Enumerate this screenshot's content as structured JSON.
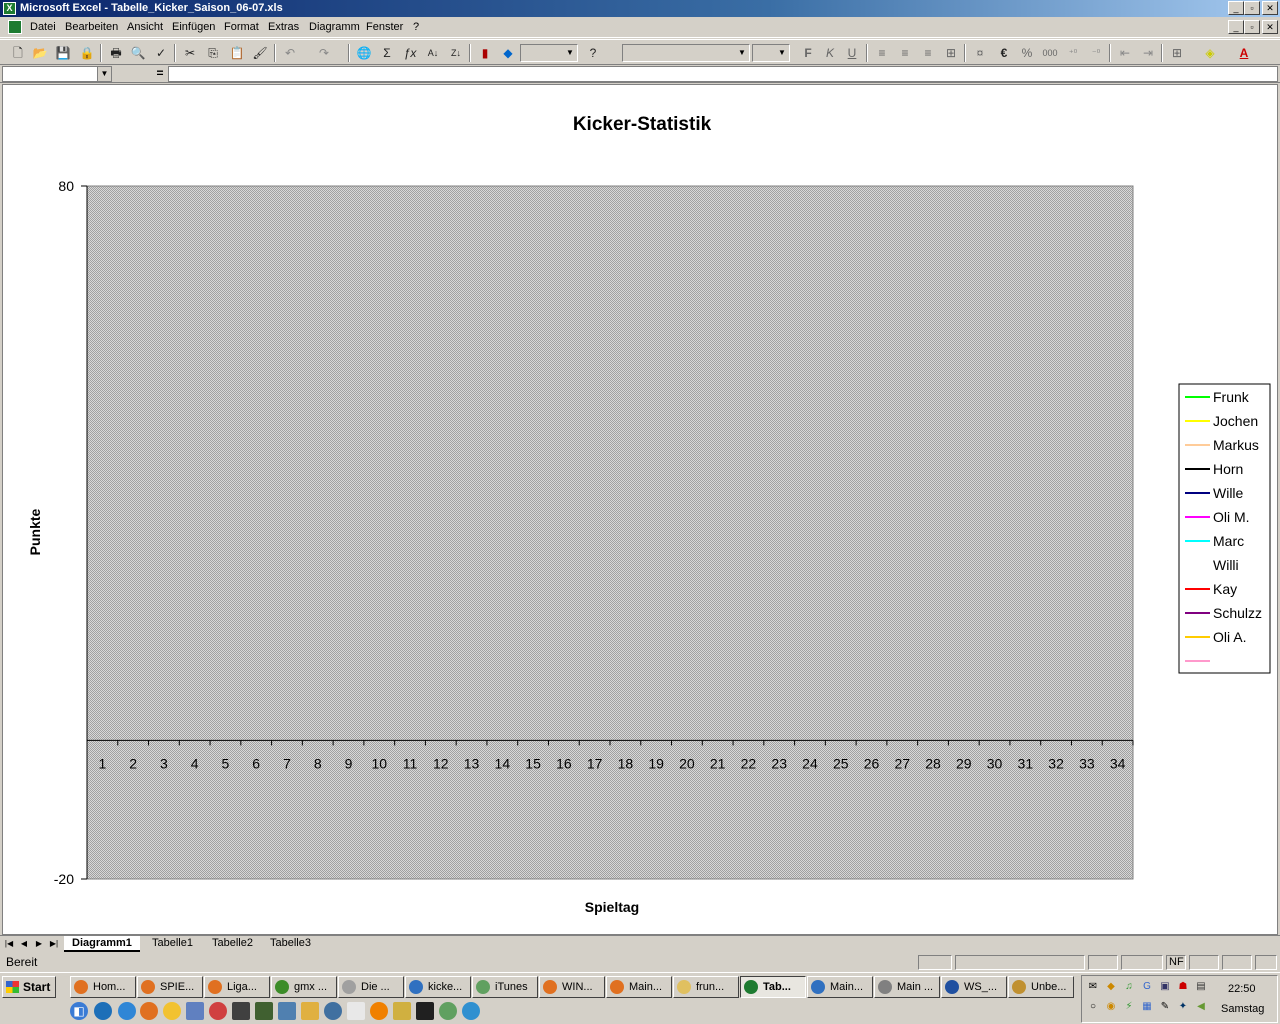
{
  "window": {
    "title": "Microsoft Excel - Tabelle_Kicker_Saison_06-07.xls",
    "min_label": "_",
    "max_label": "▫",
    "close_label": "✕",
    "doc_min_label": "_",
    "doc_max_label": "▫",
    "doc_close_label": "✕"
  },
  "menubar": {
    "items": [
      "Datei",
      "Bearbeiten",
      "Ansicht",
      "Einfügen",
      "Format",
      "Extras",
      "Diagramm",
      "Fenster",
      "?"
    ]
  },
  "toolbar": {
    "icons": [
      "new-icon",
      "open-icon",
      "save-icon",
      "permission-icon",
      "print-icon",
      "print-preview-icon",
      "spelling-icon",
      "cut-icon",
      "copy-icon",
      "paste-icon",
      "format-painter-icon",
      "undo-icon",
      "redo-icon",
      "hyperlink-icon",
      "autosum-icon",
      "function-icon",
      "sort-asc-icon",
      "sort-desc-icon",
      "chart-wizard-icon",
      "drawing-icon"
    ],
    "zoom_value": "",
    "font_name": "",
    "font_size": "",
    "bold_label": "F",
    "italic_label": "K",
    "underline_label": "U",
    "euro_label": "€",
    "percent_label": "%",
    "thousands_label": "000",
    "font_color_label": "A"
  },
  "formulabar": {
    "name_box_value": "",
    "equals_label": "=",
    "formula_value": ""
  },
  "chart_data": {
    "type": "line",
    "title": "Kicker-Statistik",
    "xlabel": "Spieltag",
    "ylabel": "Punkte",
    "ylim": [
      -20,
      80
    ],
    "y_ticks": [
      "80",
      "-20"
    ],
    "categories": [
      "1",
      "2",
      "3",
      "4",
      "5",
      "6",
      "7",
      "8",
      "9",
      "10",
      "11",
      "12",
      "13",
      "14",
      "15",
      "16",
      "17",
      "18",
      "19",
      "20",
      "21",
      "22",
      "23",
      "24",
      "25",
      "26",
      "27",
      "28",
      "29",
      "30",
      "31",
      "32",
      "33",
      "34"
    ],
    "plot_background": "#c0c0c0",
    "legend_position": "right",
    "series": [
      {
        "name": "Frunk",
        "color": "#00ff00",
        "values": []
      },
      {
        "name": "Jochen",
        "color": "#ffff00",
        "values": []
      },
      {
        "name": "Markus",
        "color": "#ffcc99",
        "values": []
      },
      {
        "name": "Horn",
        "color": "#000000",
        "values": []
      },
      {
        "name": "Wille",
        "color": "#000080",
        "values": []
      },
      {
        "name": "Oli M.",
        "color": "#ff00ff",
        "values": []
      },
      {
        "name": "Marc",
        "color": "#00ffff",
        "values": []
      },
      {
        "name": "Willi",
        "color": "#ffffff",
        "values": []
      },
      {
        "name": "Kay",
        "color": "#ff0000",
        "values": []
      },
      {
        "name": "Schulzz",
        "color": "#800080",
        "values": []
      },
      {
        "name": "Oli A.",
        "color": "#ffcc00",
        "values": []
      },
      {
        "name": "",
        "color": "#ff99cc",
        "values": []
      }
    ]
  },
  "sheettabs": {
    "tabs": [
      "Diagramm1",
      "Tabelle1",
      "Tabelle2",
      "Tabelle3"
    ],
    "active": "Diagramm1"
  },
  "statusbar": {
    "status": "Bereit",
    "nf_label": "NF"
  },
  "taskbar": {
    "start_label": "Start",
    "tasks": [
      {
        "label": "Hom...",
        "color": "#e07020"
      },
      {
        "label": "SPIE...",
        "color": "#e07020"
      },
      {
        "label": "Liga...",
        "color": "#e07020"
      },
      {
        "label": "gmx ...",
        "color": "#3c8c28"
      },
      {
        "label": "Die ...",
        "color": "#a0a0a0"
      },
      {
        "label": "kicke...",
        "color": "#3070c0"
      },
      {
        "label": "iTunes",
        "color": "#60a060"
      },
      {
        "label": "WIN...",
        "color": "#e07020"
      },
      {
        "label": "Main...",
        "color": "#e07020"
      },
      {
        "label": "frun...",
        "color": "#e0c060"
      },
      {
        "label": "Tab...",
        "color": "#1e7b31"
      },
      {
        "label": "Main...",
        "color": "#3070c0"
      },
      {
        "label": "Main ...",
        "color": "#808080"
      },
      {
        "label": "WS_...",
        "color": "#2050a0"
      },
      {
        "label": "Unbe...",
        "color": "#c09030"
      }
    ],
    "active_task": 10,
    "clock": "22:50",
    "day": "Samstag"
  }
}
